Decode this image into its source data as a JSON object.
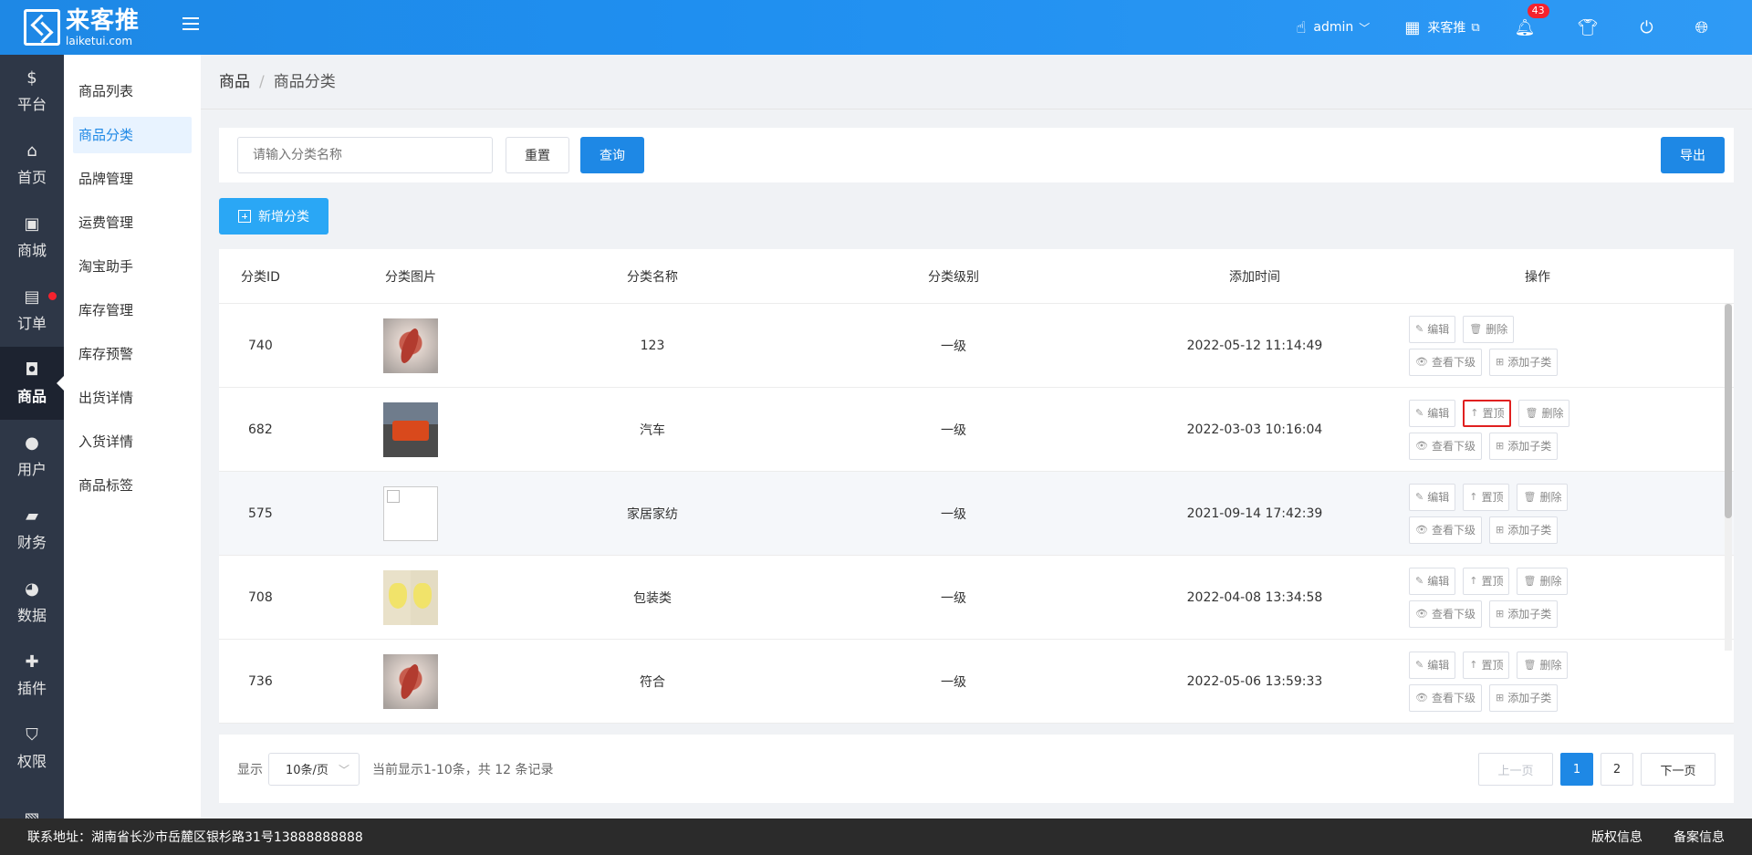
{
  "brand": {
    "name_cn": "来客推",
    "name_en": "laiketui.com"
  },
  "header": {
    "user": "admin",
    "shop": "来客推",
    "notifications": "43"
  },
  "side_icons": [
    {
      "label": "平台",
      "icon": "dollar-icon"
    },
    {
      "label": "首页",
      "icon": "home-icon"
    },
    {
      "label": "商城",
      "icon": "shop-icon"
    },
    {
      "label": "订单",
      "icon": "clipboard-icon"
    },
    {
      "label": "商品",
      "icon": "bag-icon"
    },
    {
      "label": "用户",
      "icon": "user-icon"
    },
    {
      "label": "财务",
      "icon": "wallet-icon"
    },
    {
      "label": "数据",
      "icon": "pie-chart-icon"
    },
    {
      "label": "插件",
      "icon": "puzzle-icon"
    },
    {
      "label": "权限",
      "icon": "shield-icon"
    }
  ],
  "sub_menu": [
    "商品列表",
    "商品分类",
    "品牌管理",
    "运费管理",
    "淘宝助手",
    "库存管理",
    "库存预警",
    "出货详情",
    "入货详情",
    "商品标签"
  ],
  "breadcrumb": {
    "root": "商品",
    "sep": "/",
    "current": "商品分类"
  },
  "search": {
    "placeholder": "请输入分类名称",
    "reset": "重置",
    "query": "查询",
    "export": "导出"
  },
  "add_button": "新增分类",
  "table": {
    "headers": {
      "id": "分类ID",
      "img": "分类图片",
      "name": "分类名称",
      "level": "分类级别",
      "time": "添加时间",
      "op": "操作"
    },
    "rows": [
      {
        "id": "740",
        "name": "123",
        "level": "一级",
        "time": "2022-05-12 11:14:49"
      },
      {
        "id": "682",
        "name": "汽车",
        "level": "一级",
        "time": "2022-03-03 10:16:04"
      },
      {
        "id": "575",
        "name": "家居家纺",
        "level": "一级",
        "time": "2021-09-14 17:42:39"
      },
      {
        "id": "708",
        "name": "包装类",
        "level": "一级",
        "time": "2022-04-08 13:34:58"
      },
      {
        "id": "736",
        "name": "符合",
        "level": "一级",
        "time": "2022-05-06 13:59:33"
      }
    ],
    "ops": {
      "edit": "编辑",
      "top": "置顶",
      "delete": "删除",
      "view_sub": "查看下级",
      "add_sub": "添加子类"
    }
  },
  "pager": {
    "show": "显示",
    "page_size": "10条/页",
    "info": "当前显示1-10条，共 12 条记录",
    "prev": "上一页",
    "page1": "1",
    "page2": "2",
    "next": "下一页"
  },
  "footer": {
    "address": "联系地址：湖南省长沙市岳麓区银杉路31号13888888888",
    "copyright": "版权信息",
    "record": "备案信息"
  }
}
